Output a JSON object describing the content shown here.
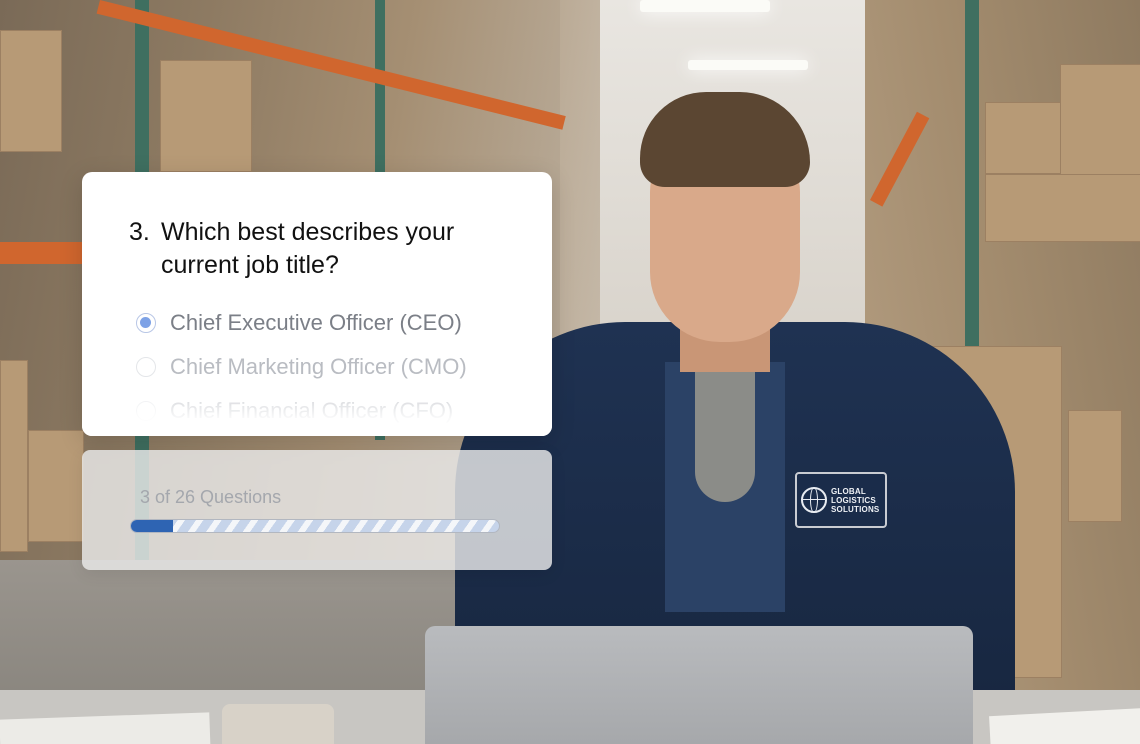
{
  "question": {
    "number": "3.",
    "text": "Which best describes your current job title?",
    "options": [
      {
        "label": "Chief Executive Officer (CEO)",
        "selected": true
      },
      {
        "label": "Chief Marketing Officer (CMO)",
        "selected": false
      },
      {
        "label": "Chief Financial Officer (CFO)",
        "selected": false
      }
    ]
  },
  "progress": {
    "label": "3 of 26 Questions",
    "current": 3,
    "total": 26,
    "fill_color": "#2e64b3"
  },
  "background": {
    "vest_patch_text": "GLOBAL LOGISTICS SOLUTIONS"
  },
  "colors": {
    "accent": "#2e64b3",
    "radio_selected": "#7ea2e6",
    "option_text": "#7b7f87"
  }
}
